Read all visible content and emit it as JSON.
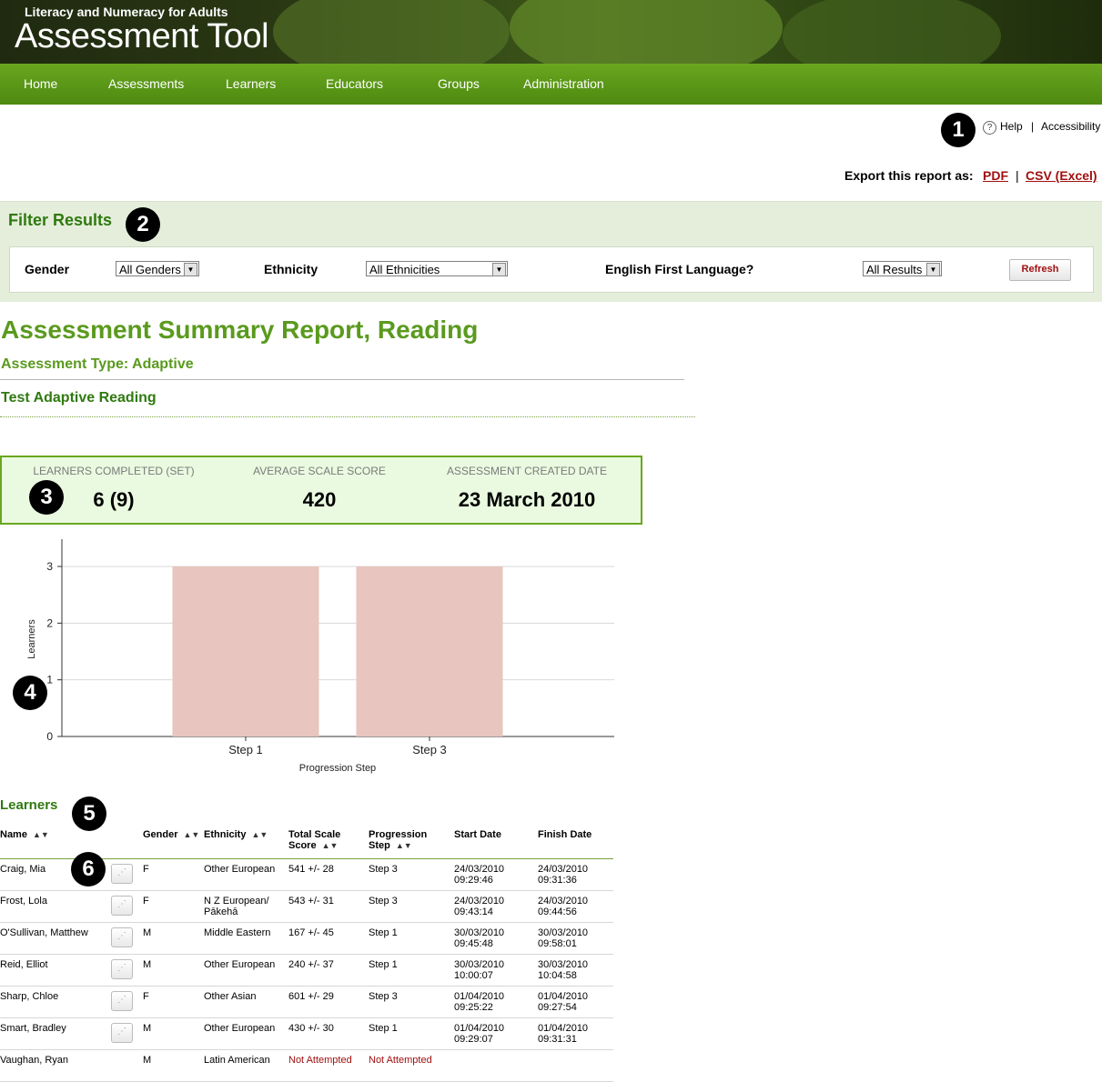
{
  "header": {
    "subtitle": "Literacy and Numeracy for Adults",
    "title": "Assessment Tool"
  },
  "nav": [
    "Home",
    "Assessments",
    "Learners",
    "Educators",
    "Groups",
    "Administration"
  ],
  "top_links": {
    "help": "Help",
    "separator": "|",
    "accessibility": "Accessibility"
  },
  "export": {
    "label": "Export this report as:",
    "pdf": "PDF",
    "separator": "|",
    "csv": "CSV (Excel)"
  },
  "filter": {
    "title": "Filter Results",
    "gender_label": "Gender",
    "gender_value": "All Genders",
    "ethnicity_label": "Ethnicity",
    "ethnicity_value": "All Ethnicities",
    "efl_label": "English First Language?",
    "efl_value": "All Results",
    "refresh": "Refresh"
  },
  "report": {
    "title": "Assessment Summary Report, Reading",
    "type": "Assessment Type: Adaptive",
    "test_name": "Test Adaptive Reading"
  },
  "summary": {
    "completed_label": "LEARNERS COMPLETED (SET)",
    "completed_value": "6 (9)",
    "avg_label": "AVERAGE SCALE SCORE",
    "avg_value": "420",
    "created_label": "ASSESSMENT CREATED DATE",
    "created_value": "23 March 2010"
  },
  "badges": [
    "1",
    "2",
    "3",
    "4",
    "5",
    "6"
  ],
  "chart_data": {
    "type": "bar",
    "categories": [
      "Step 1",
      "Step 3"
    ],
    "values": [
      3,
      3
    ],
    "xlabel": "Progression Step",
    "ylabel": "Learners",
    "ylim": [
      0,
      3
    ],
    "yticks": [
      "0",
      "1",
      "2",
      "3"
    ],
    "grid": true,
    "bar_color": "#e8c5be"
  },
  "learners": {
    "title": "Learners",
    "columns": [
      "Name",
      "Gender",
      "Ethnicity",
      "Total Scale Score",
      "Progression Step",
      "Start Date",
      "Finish Date"
    ],
    "rows": [
      {
        "name": "Craig, Mia",
        "gender": "F",
        "ethnicity": "Other European",
        "score": "541 +/- 28",
        "step": "Step 3",
        "start": "24/03/2010 09:29:46",
        "finish": "24/03/2010 09:31:36"
      },
      {
        "name": "Frost, Lola",
        "gender": "F",
        "ethnicity": "N Z European/ Pākehā",
        "score": "543 +/- 31",
        "step": "Step 3",
        "start": "24/03/2010 09:43:14",
        "finish": "24/03/2010 09:44:56"
      },
      {
        "name": "O'Sullivan, Matthew",
        "gender": "M",
        "ethnicity": "Middle Eastern",
        "score": "167 +/- 45",
        "step": "Step 1",
        "start": "30/03/2010 09:45:48",
        "finish": "30/03/2010 09:58:01"
      },
      {
        "name": "Reid, Elliot",
        "gender": "M",
        "ethnicity": "Other European",
        "score": "240 +/- 37",
        "step": "Step 1",
        "start": "30/03/2010 10:00:07",
        "finish": "30/03/2010 10:04:58"
      },
      {
        "name": "Sharp, Chloe",
        "gender": "F",
        "ethnicity": "Other Asian",
        "score": "601 +/- 29",
        "step": "Step 3",
        "start": "01/04/2010 09:25:22",
        "finish": "01/04/2010 09:27:54"
      },
      {
        "name": "Smart, Bradley",
        "gender": "M",
        "ethnicity": "Other European",
        "score": "430 +/- 30",
        "step": "Step 1",
        "start": "01/04/2010 09:29:07",
        "finish": "01/04/2010 09:31:31"
      },
      {
        "name": "Vaughan, Ryan",
        "gender": "M",
        "ethnicity": "Latin American",
        "score": "Not Attempted",
        "step": "Not Attempted",
        "start": "",
        "finish": ""
      }
    ]
  }
}
